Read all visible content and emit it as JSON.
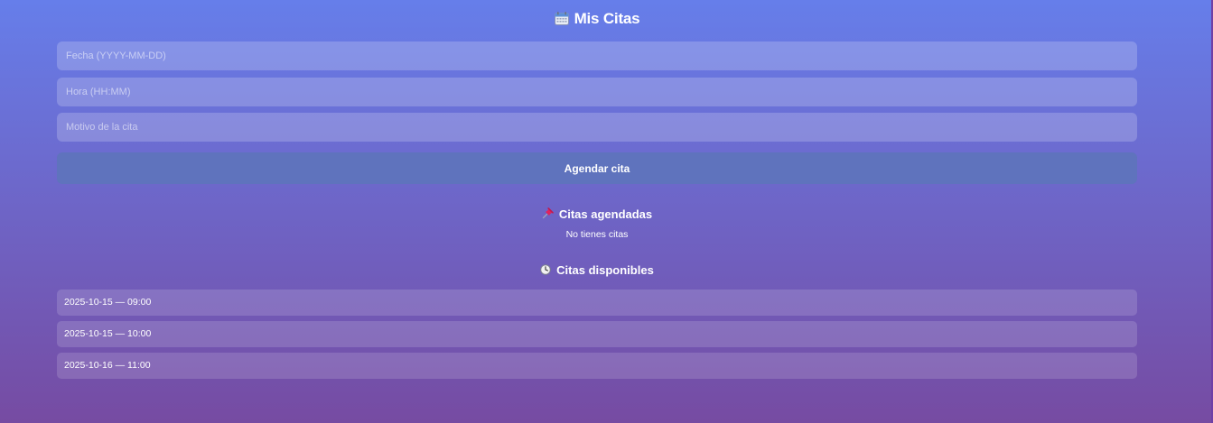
{
  "header": {
    "icon": "calendar-icon",
    "title": "Mis Citas"
  },
  "form": {
    "fecha_placeholder": "Fecha (YYYY-MM-DD)",
    "hora_placeholder": "Hora (HH:MM)",
    "motivo_placeholder": "Motivo de la cita",
    "fecha_value": "",
    "hora_value": "",
    "motivo_value": "",
    "submit_label": "Agendar cita"
  },
  "booked": {
    "icon": "pushpin-icon",
    "heading": "Citas agendadas",
    "empty_message": "No tienes citas"
  },
  "available": {
    "icon": "clock-icon",
    "heading": "Citas disponibles",
    "slots": [
      "2025-10-15 — 09:00",
      "2025-10-15 — 10:00",
      "2025-10-16 — 11:00"
    ]
  },
  "colors": {
    "gradient_top": "#667eea",
    "gradient_bottom": "#764ba2",
    "button": "#5f73bd",
    "text": "#ffffff"
  }
}
